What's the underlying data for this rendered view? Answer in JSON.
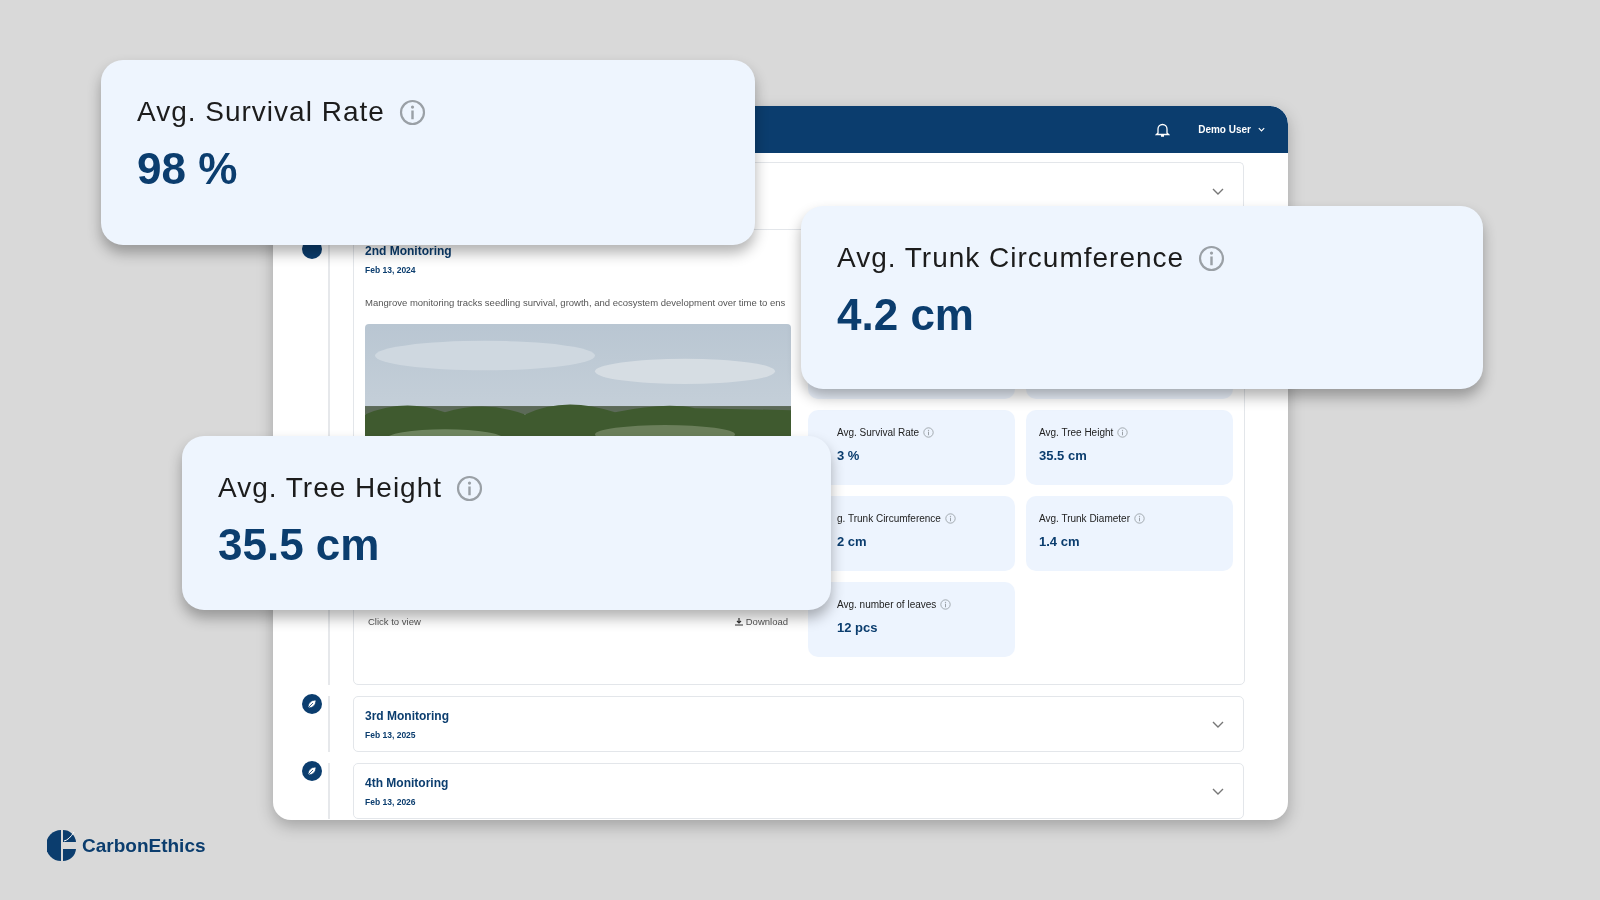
{
  "header": {
    "user": "Demo User"
  },
  "monitorings": [
    {
      "expanded": false
    },
    {
      "expanded": true,
      "title": "2nd Monitoring",
      "date": "Feb 13, 2024",
      "description": "Mangrove monitoring tracks seedling survival, growth, and ecosystem development over time to ens",
      "view_label": "Click to view",
      "download_label": "Download",
      "stats": [
        {
          "hidden": true
        },
        {
          "hidden": true
        },
        {
          "hidden": false,
          "covered": true,
          "label": "Avg. Survival Rate",
          "value": "3 %"
        },
        {
          "hidden": false,
          "covered": false,
          "label": "Avg. Tree Height",
          "value": "35.5 cm"
        },
        {
          "hidden": false,
          "covered": true,
          "label": "g. Trunk Circumference",
          "value": "2 cm"
        },
        {
          "hidden": false,
          "covered": false,
          "label": "Avg. Trunk Diameter",
          "value": "1.4 cm"
        },
        {
          "hidden": false,
          "covered": true,
          "label": "Avg. number of leaves",
          "value": "12 pcs"
        }
      ]
    },
    {
      "expanded": false,
      "title": "3rd Monitoring",
      "date": "Feb 13, 2025"
    },
    {
      "expanded": false,
      "title": "4th Monitoring",
      "date": "Feb 13, 2026"
    }
  ],
  "highlights": [
    {
      "label": "Avg. Survival Rate",
      "value": "98 %"
    },
    {
      "label": "Avg. Trunk Circumference",
      "value": "4.2 cm"
    },
    {
      "label": "Avg. Tree Height",
      "value": "35.5 cm"
    }
  ],
  "brand": {
    "name": "CarbonEthics"
  }
}
